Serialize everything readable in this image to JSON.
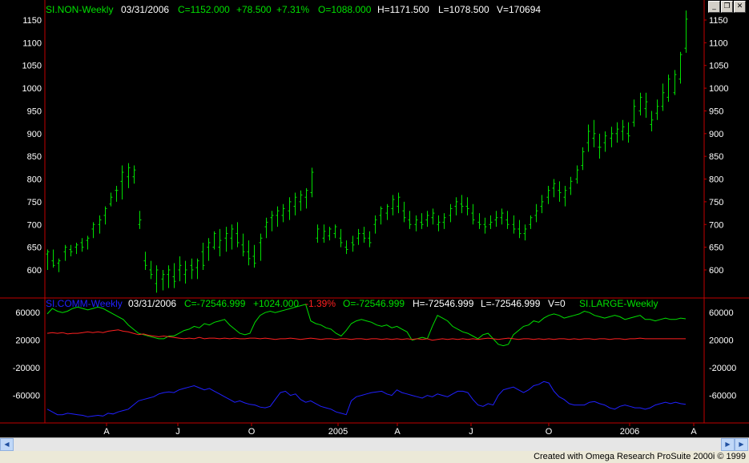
{
  "window": {
    "minimize_label": "_",
    "restore_label": "❐",
    "close_label": "✕"
  },
  "price_header": {
    "symbol": "SI.NON-Weekly",
    "date": "03/31/2006",
    "close": "C=1152.000",
    "change": "+78.500",
    "pct": "+7.31%",
    "open": "O=1088.000",
    "high": "H=1171.500",
    "low": "L=1078.500",
    "volume": "V=170694"
  },
  "cot_header": {
    "symbol": "SI.COMM-Weekly",
    "date": "03/31/2006",
    "close": "C=-72546.999",
    "change": "+1024.000",
    "pct": "-1.39%",
    "open": "O=-72546.999",
    "high": "H=-72546.999",
    "low": "L=-72546.999",
    "volume": "V=0",
    "second_symbol": "SI.LARGE-Weekly"
  },
  "scroll": {
    "left_arrow": "◀",
    "right_arrow": "▶"
  },
  "status": {
    "credit": "Created with Omega Research ProSuite 2000i © 1999"
  },
  "colors": {
    "background": "#000000",
    "price_bars": "#00e000",
    "commercial": "#2020ff",
    "large": "#00e000",
    "small": "#ff2020",
    "frame": "#c00000"
  },
  "chart_data": [
    {
      "type": "ohlc",
      "title": "SI.NON-Weekly",
      "ylim": [
        540,
        1180
      ],
      "y_ticks": [
        600,
        650,
        700,
        750,
        800,
        850,
        900,
        950,
        1000,
        1050,
        1100,
        1150
      ],
      "x_labels": [
        "A",
        "J",
        "O",
        "2005",
        "A",
        "J",
        "O",
        "2006",
        "A"
      ],
      "bars": [
        [
          635,
          645,
          600,
          640
        ],
        [
          620,
          645,
          605,
          610
        ],
        [
          615,
          625,
          595,
          620
        ],
        [
          640,
          655,
          620,
          650
        ],
        [
          645,
          655,
          630,
          640
        ],
        [
          650,
          660,
          635,
          655
        ],
        [
          660,
          670,
          640,
          650
        ],
        [
          665,
          675,
          645,
          670
        ],
        [
          690,
          705,
          670,
          700
        ],
        [
          700,
          720,
          680,
          710
        ],
        [
          720,
          740,
          700,
          735
        ],
        [
          745,
          770,
          740,
          760
        ],
        [
          775,
          785,
          750,
          775
        ],
        [
          795,
          830,
          755,
          815
        ],
        [
          805,
          835,
          780,
          825
        ],
        [
          805,
          830,
          790,
          820
        ],
        [
          700,
          730,
          690,
          710
        ],
        [
          620,
          640,
          600,
          610
        ],
        [
          600,
          620,
          580,
          590
        ],
        [
          570,
          610,
          550,
          600
        ],
        [
          580,
          600,
          555,
          590
        ],
        [
          590,
          610,
          560,
          600
        ],
        [
          585,
          615,
          560,
          575
        ],
        [
          600,
          630,
          575,
          610
        ],
        [
          590,
          620,
          570,
          600
        ],
        [
          610,
          625,
          580,
          600
        ],
        [
          605,
          625,
          580,
          620
        ],
        [
          640,
          660,
          600,
          610
        ],
        [
          650,
          670,
          620,
          660
        ],
        [
          650,
          685,
          645,
          680
        ],
        [
          650,
          690,
          630,
          665
        ],
        [
          670,
          695,
          640,
          680
        ],
        [
          670,
          700,
          645,
          690
        ],
        [
          680,
          705,
          650,
          660
        ],
        [
          655,
          680,
          630,
          640
        ],
        [
          640,
          665,
          610,
          625
        ],
        [
          630,
          655,
          605,
          615
        ],
        [
          660,
          680,
          620,
          670
        ],
        [
          695,
          715,
          670,
          705
        ],
        [
          715,
          730,
          685,
          720
        ],
        [
          720,
          740,
          695,
          730
        ],
        [
          720,
          745,
          705,
          735
        ],
        [
          730,
          760,
          710,
          750
        ],
        [
          740,
          770,
          720,
          760
        ],
        [
          750,
          775,
          730,
          765
        ],
        [
          760,
          780,
          735,
          775
        ],
        [
          770,
          825,
          760,
          815
        ],
        [
          670,
          700,
          660,
          690
        ],
        [
          670,
          700,
          660,
          685
        ],
        [
          675,
          695,
          665,
          690
        ],
        [
          680,
          700,
          670,
          695
        ],
        [
          670,
          690,
          650,
          660
        ],
        [
          650,
          665,
          635,
          645
        ],
        [
          660,
          675,
          640,
          655
        ],
        [
          670,
          690,
          655,
          680
        ],
        [
          680,
          695,
          660,
          670
        ],
        [
          670,
          685,
          650,
          660
        ],
        [
          700,
          720,
          680,
          710
        ],
        [
          720,
          740,
          700,
          735
        ],
        [
          725,
          745,
          710,
          740
        ],
        [
          735,
          765,
          720,
          755
        ],
        [
          740,
          770,
          725,
          760
        ],
        [
          730,
          750,
          705,
          715
        ],
        [
          710,
          730,
          690,
          700
        ],
        [
          700,
          720,
          685,
          710
        ],
        [
          705,
          725,
          690,
          700
        ],
        [
          710,
          730,
          695,
          720
        ],
        [
          715,
          735,
          700,
          725
        ],
        [
          700,
          720,
          685,
          705
        ],
        [
          705,
          725,
          690,
          715
        ],
        [
          720,
          745,
          705,
          735
        ],
        [
          740,
          760,
          720,
          750
        ],
        [
          745,
          765,
          725,
          740
        ],
        [
          740,
          760,
          720,
          735
        ],
        [
          725,
          745,
          700,
          710
        ],
        [
          705,
          725,
          690,
          700
        ],
        [
          700,
          715,
          680,
          695
        ],
        [
          700,
          720,
          690,
          705
        ],
        [
          710,
          730,
          695,
          715
        ],
        [
          715,
          735,
          700,
          725
        ],
        [
          710,
          730,
          690,
          700
        ],
        [
          700,
          720,
          680,
          690
        ],
        [
          690,
          710,
          670,
          680
        ],
        [
          680,
          700,
          665,
          690
        ],
        [
          700,
          720,
          690,
          715
        ],
        [
          720,
          745,
          705,
          730
        ],
        [
          740,
          765,
          725,
          750
        ],
        [
          760,
          785,
          745,
          775
        ],
        [
          780,
          800,
          760,
          790
        ],
        [
          775,
          795,
          750,
          770
        ],
        [
          760,
          785,
          740,
          775
        ],
        [
          780,
          805,
          765,
          795
        ],
        [
          800,
          830,
          790,
          820
        ],
        [
          830,
          870,
          820,
          860
        ],
        [
          880,
          920,
          860,
          905
        ],
        [
          890,
          930,
          870,
          900
        ],
        [
          870,
          900,
          845,
          870
        ],
        [
          880,
          905,
          860,
          895
        ],
        [
          890,
          915,
          870,
          900
        ],
        [
          900,
          925,
          880,
          910
        ],
        [
          905,
          930,
          885,
          915
        ],
        [
          900,
          925,
          880,
          895
        ],
        [
          925,
          975,
          915,
          960
        ],
        [
          950,
          990,
          940,
          980
        ],
        [
          955,
          990,
          935,
          970
        ],
        [
          920,
          950,
          905,
          930
        ],
        [
          945,
          975,
          930,
          960
        ],
        [
          960,
          1010,
          950,
          990
        ],
        [
          980,
          1030,
          970,
          1020
        ],
        [
          990,
          1040,
          985,
          1030
        ],
        [
          1020,
          1080,
          1010,
          1074
        ],
        [
          1088,
          1171,
          1078,
          1152
        ]
      ]
    },
    {
      "type": "line",
      "title": "SI.COMM-Weekly",
      "ylim": [
        -100000,
        80000
      ],
      "y_ticks": [
        60000,
        20000,
        -20000,
        -60000
      ],
      "series": [
        {
          "name": "SI.COMM-Weekly",
          "color": "#2020ff",
          "values": [
            -80000,
            -84000,
            -88000,
            -88000,
            -86000,
            -87000,
            -88000,
            -89000,
            -91000,
            -90000,
            -89000,
            -90000,
            -86000,
            -87000,
            -84000,
            -82000,
            -80000,
            -74000,
            -68000,
            -66000,
            -64000,
            -62000,
            -58000,
            -56000,
            -55000,
            -56000,
            -52000,
            -50000,
            -48000,
            -46000,
            -49000,
            -52000,
            -50000,
            -54000,
            -58000,
            -62000,
            -66000,
            -70000,
            -68000,
            -71000,
            -73000,
            -74000,
            -77000,
            -78000,
            -76000,
            -66000,
            -56000,
            -54000,
            -60000,
            -58000,
            -66000,
            -70000,
            -68000,
            -72000,
            -76000,
            -78000,
            -80000,
            -84000,
            -86000,
            -88000,
            -68000,
            -62000,
            -60000,
            -58000,
            -56000,
            -55000,
            -54000,
            -58000,
            -60000,
            -52000,
            -56000,
            -58000,
            -60000,
            -62000,
            -64000,
            -60000,
            -62000,
            -58000,
            -60000,
            -62000,
            -58000,
            -54000,
            -54000,
            -56000,
            -66000,
            -74000,
            -76000,
            -72000,
            -74000,
            -60000,
            -52000,
            -50000,
            -48000,
            -52000,
            -56000,
            -52000,
            -46000,
            -44000,
            -40000,
            -42000,
            -54000,
            -62000,
            -66000,
            -72000,
            -74000,
            -74000,
            -74000,
            -70000,
            -69000,
            -72000,
            -74000,
            -78000,
            -80000,
            -76000,
            -74000,
            -76000,
            -78000,
            -78000,
            -80000,
            -78000,
            -74000,
            -72000,
            -70000,
            -72000,
            -70000,
            -72000,
            -73000
          ]
        },
        {
          "name": "SI.LARGE-Weekly",
          "color": "#00e000",
          "values": [
            58000,
            66000,
            62000,
            60000,
            62000,
            66000,
            68000,
            66000,
            64000,
            66000,
            68000,
            66000,
            62000,
            58000,
            54000,
            50000,
            42000,
            36000,
            30000,
            28000,
            26000,
            24000,
            22000,
            22000,
            26000,
            26000,
            30000,
            34000,
            36000,
            40000,
            38000,
            44000,
            42000,
            46000,
            48000,
            50000,
            42000,
            36000,
            30000,
            28000,
            30000,
            46000,
            56000,
            60000,
            62000,
            60000,
            62000,
            64000,
            66000,
            68000,
            70000,
            72000,
            48000,
            44000,
            42000,
            38000,
            36000,
            30000,
            26000,
            34000,
            44000,
            48000,
            50000,
            48000,
            46000,
            42000,
            40000,
            42000,
            38000,
            40000,
            36000,
            32000,
            20000,
            22000,
            24000,
            22000,
            40000,
            56000,
            52000,
            48000,
            40000,
            36000,
            32000,
            30000,
            26000,
            22000,
            28000,
            30000,
            22000,
            14000,
            12000,
            14000,
            28000,
            34000,
            40000,
            42000,
            48000,
            46000,
            52000,
            56000,
            58000,
            56000,
            52000,
            54000,
            56000,
            58000,
            62000,
            60000,
            56000,
            54000,
            52000,
            54000,
            56000,
            54000,
            50000,
            52000,
            54000,
            56000,
            50000,
            50000,
            48000,
            50000,
            52000,
            50000,
            50000,
            52000,
            51000
          ]
        },
        {
          "name": "SI.SMALL-Weekly",
          "color": "#ff2020",
          "values": [
            30000,
            31000,
            30000,
            31000,
            29000,
            30000,
            30000,
            31000,
            32000,
            31000,
            32000,
            31000,
            33000,
            34000,
            35000,
            33000,
            32000,
            30000,
            28000,
            29000,
            27000,
            26000,
            25000,
            26000,
            25000,
            24000,
            23000,
            22000,
            23000,
            22000,
            24000,
            22000,
            23000,
            23000,
            22000,
            23000,
            22000,
            23000,
            22000,
            22000,
            23000,
            23000,
            22000,
            23000,
            22000,
            21000,
            22000,
            22000,
            23000,
            22000,
            21000,
            22000,
            23000,
            22000,
            21000,
            22000,
            22000,
            21000,
            22000,
            22000,
            21000,
            22000,
            22000,
            21000,
            22000,
            22000,
            21000,
            22000,
            21000,
            22000,
            21000,
            22000,
            21000,
            22000,
            21000,
            22000,
            20000,
            21000,
            22000,
            21000,
            22000,
            21000,
            22000,
            21000,
            22000,
            21000,
            22000,
            23000,
            22000,
            21000,
            22000,
            23000,
            22000,
            21000,
            22000,
            22000,
            21000,
            22000,
            21000,
            22000,
            21000,
            22000,
            22000,
            21000,
            22000,
            21000,
            22000,
            22000,
            21000,
            22000,
            22000,
            21000,
            22000,
            22000,
            21000,
            22000,
            22000,
            23000,
            22000,
            22000,
            22000,
            22000,
            22000,
            22000,
            22000,
            22000,
            22000
          ]
        }
      ]
    }
  ]
}
